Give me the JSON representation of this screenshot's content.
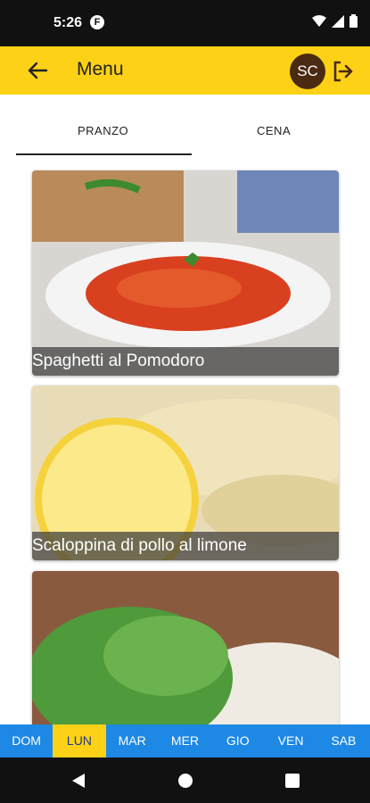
{
  "status_bar": {
    "time": "5:26",
    "notification_badge": "F",
    "icons": [
      "wifi-icon",
      "signal-icon",
      "battery-icon"
    ]
  },
  "appbar": {
    "title": "Menu",
    "avatar_initials": "SC",
    "back_icon": "arrow-left-icon",
    "logout_icon": "logout-icon",
    "color": "#fcd116"
  },
  "tabs": [
    {
      "label": "PRANZO",
      "selected": true
    },
    {
      "label": "CENA",
      "selected": false
    }
  ],
  "dishes": [
    {
      "name": "Spaghetti al Pomodoro",
      "image": "spaghetti-image"
    },
    {
      "name": "Scaloppina di pollo al limone",
      "image": "scaloppina-image"
    },
    {
      "name": "",
      "image": "salad-image"
    }
  ],
  "days": [
    {
      "label": "DOM",
      "selected": false
    },
    {
      "label": "LUN",
      "selected": true
    },
    {
      "label": "MAR",
      "selected": false
    },
    {
      "label": "MER",
      "selected": false
    },
    {
      "label": "GIO",
      "selected": false
    },
    {
      "label": "VEN",
      "selected": false
    },
    {
      "label": "SAB",
      "selected": false
    }
  ],
  "colors": {
    "accent": "#fcd116",
    "days_bar": "#1e88e5",
    "avatar": "#4b2a12"
  }
}
